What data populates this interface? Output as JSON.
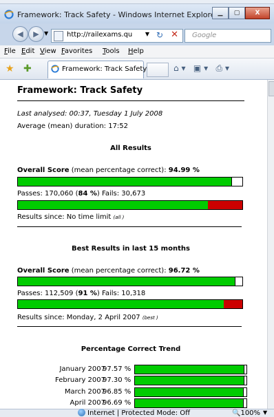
{
  "window": {
    "title": "Framework: Track Safety - Windows Internet Explorer",
    "buttons": {
      "minimize": "▁",
      "maximize": "▢",
      "close": "X"
    }
  },
  "address_bar": {
    "url": "http://railexams.qu",
    "search_placeholder": "Google"
  },
  "menu": {
    "items": [
      {
        "key": "F",
        "rest": "ile"
      },
      {
        "key": "E",
        "rest": "dit"
      },
      {
        "key": "V",
        "rest": "iew"
      },
      {
        "key": "F",
        "rest": "avorites"
      },
      {
        "key": "T",
        "rest": "ools"
      },
      {
        "key": "H",
        "rest": "elp"
      }
    ]
  },
  "tab": {
    "title": "Framework: Track Safety"
  },
  "page": {
    "heading": "Framework: Track Safety",
    "last_analysed": "Last analysed: 00:37, Tuesday 1 July 2008",
    "average_duration": "Average (mean) duration: 17:52",
    "all_results": {
      "title": "All Results",
      "score_label": "Overall Score",
      "score_desc": " (mean percentage correct): ",
      "score_value": "94.99 %",
      "score_fraction": 0.9499,
      "passes_prefix": "Passes: 170,060 (",
      "passes_pct": "84 %",
      "passes_suffix": ")   Fails: 30,673",
      "pass_fraction": 0.847,
      "since_text": "Results since: No time limit ",
      "since_note": "(all )"
    },
    "best_results": {
      "title": "Best Results in last 15 months",
      "score_label": "Overall Score",
      "score_desc": " (mean percentage correct): ",
      "score_value": "96.72 %",
      "score_fraction": 0.9672,
      "passes_prefix": "Passes: 112,509 (",
      "passes_pct": "91 %",
      "passes_suffix": ")   Fails: 10,318",
      "pass_fraction": 0.916,
      "since_text": "Results since: Monday, 2 April 2007 ",
      "since_note": "(best )"
    },
    "trend": {
      "title": "Percentage Correct Trend",
      "rows": [
        {
          "month": "January 2007",
          "pct": "97.57 %",
          "value": 0.9757
        },
        {
          "month": "February 2007",
          "pct": "97.30 %",
          "value": 0.973
        },
        {
          "month": "March 2007",
          "pct": "96.85 %",
          "value": 0.9685
        },
        {
          "month": "April 2007",
          "pct": "96.69 %",
          "value": 0.9669
        }
      ]
    }
  },
  "status_bar": {
    "status": "Internet | Protected Mode: Off",
    "zoom": "100%"
  },
  "colors": {
    "pass_green": "#00cc00",
    "fail_red": "#cc0000",
    "chrome_blue": "#c7d6ea"
  }
}
